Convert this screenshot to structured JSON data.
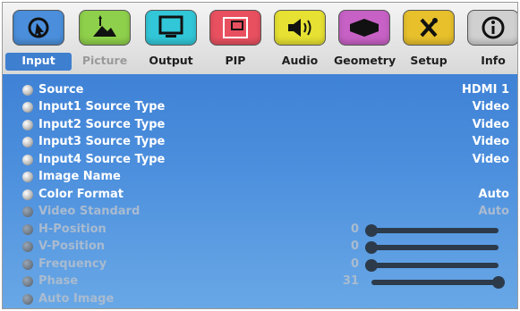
{
  "tabs": [
    {
      "label": "Input",
      "icon": "input-arrow-icon",
      "color": "#4b8fdc",
      "state": "active"
    },
    {
      "label": "Picture",
      "icon": "picture-landscape-icon",
      "color": "#8ed04b",
      "state": "dim"
    },
    {
      "label": "Output",
      "icon": "monitor-icon",
      "color": "#32c7d8",
      "state": "normal"
    },
    {
      "label": "PIP",
      "icon": "pip-window-icon",
      "color": "#e85060",
      "state": "normal"
    },
    {
      "label": "Audio",
      "icon": "speaker-icon",
      "color": "#e6e132",
      "state": "normal"
    },
    {
      "label": "Geometry",
      "icon": "geometry-icon",
      "color": "#c761c5",
      "state": "normal"
    },
    {
      "label": "Setup",
      "icon": "tools-icon",
      "color": "#e7c02c",
      "state": "normal"
    },
    {
      "label": "Info",
      "icon": "info-icon",
      "color": "#d0d0d0",
      "state": "normal"
    }
  ],
  "rows": [
    {
      "label": "Source",
      "value": "HDMI 1",
      "state": "normal"
    },
    {
      "label": "Input1 Source Type",
      "value": "Video",
      "state": "normal"
    },
    {
      "label": "Input2 Source Type",
      "value": "Video",
      "state": "normal"
    },
    {
      "label": "Input3 Source Type",
      "value": "Video",
      "state": "normal"
    },
    {
      "label": "Input4 Source Type",
      "value": "Video",
      "state": "normal"
    },
    {
      "label": "Image Name",
      "value": "",
      "state": "normal"
    },
    {
      "label": "Color Format",
      "value": "Auto",
      "state": "normal"
    },
    {
      "label": "Video Standard",
      "value": "Auto",
      "state": "dim"
    },
    {
      "label": "H-Position",
      "number": "0",
      "slider_level": 0.0,
      "state": "dim"
    },
    {
      "label": "V-Position",
      "number": "0",
      "slider_level": 0.0,
      "state": "dim"
    },
    {
      "label": "Frequency",
      "number": "0",
      "slider_level": 0.0,
      "state": "dim"
    },
    {
      "label": "Phase",
      "number": "31",
      "slider_level": 1.0,
      "state": "dim"
    },
    {
      "label": "Auto Image",
      "value": "",
      "state": "dim"
    }
  ],
  "colors": {
    "panel": "#4c8fdd",
    "active_tab": "#3f7fd0"
  }
}
